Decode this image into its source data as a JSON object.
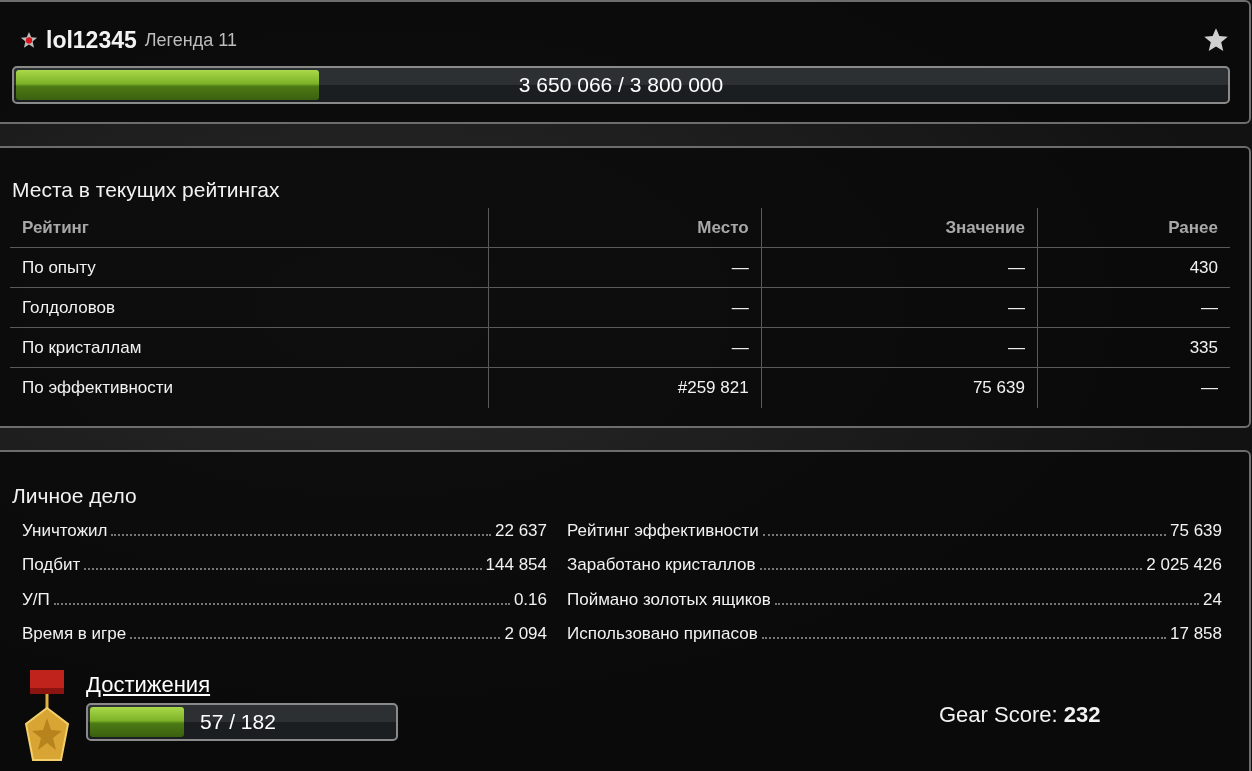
{
  "profile": {
    "username": "lol12345",
    "rank": "Легенда 11",
    "favorite": false,
    "experience": {
      "reading": "3 650 066 / 3 800 000",
      "level": 0.25
    }
  },
  "ratings": {
    "title": "Места в текущих рейтингах",
    "columns": [
      "Рейтинг",
      "Место",
      "Значение",
      "Ранее"
    ],
    "rows": [
      [
        "По опыту",
        "—",
        "—",
        "430"
      ],
      [
        "Голдоловов",
        "—",
        "—",
        "—"
      ],
      [
        "По кристаллам",
        "—",
        "—",
        "335"
      ],
      [
        "По эффективности",
        "#259 821",
        "75 639",
        "—"
      ]
    ]
  },
  "record": {
    "title": "Личное дело",
    "left": [
      {
        "label": "Уничтожил",
        "value": "22 637"
      },
      {
        "label": "Подбит",
        "value": "144 854"
      },
      {
        "label": "У/П",
        "value": "0.16"
      },
      {
        "label": "Время в игре",
        "value": "2 094"
      }
    ],
    "right": [
      {
        "label": "Рейтинг эффективности",
        "value": "75 639"
      },
      {
        "label": "Заработано кристаллов",
        "value": "2 025 426"
      },
      {
        "label": "Поймано золотых ящиков",
        "value": "24"
      },
      {
        "label": "Использовано припасов",
        "value": "17 858"
      }
    ],
    "achievements": {
      "link": "Достижения",
      "reading": "57 / 182",
      "level": 0.31
    },
    "gear_score": "Gear Score: **232**"
  }
}
